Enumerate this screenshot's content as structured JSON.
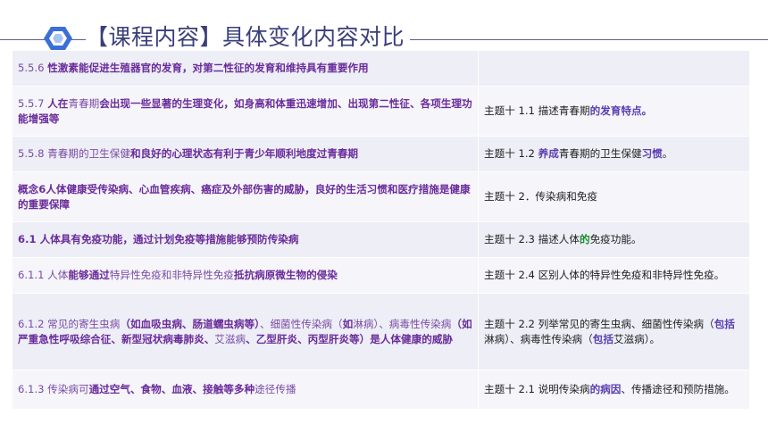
{
  "header": {
    "title": "【课程内容】具体变化内容对比"
  },
  "rows": [
    {
      "left": [
        {
          "t": "5.5.6 ",
          "s": "n"
        },
        {
          "t": "性激素能促进生殖器官的发育，对第二性征的发育和维持具有重要作用",
          "s": "b"
        }
      ],
      "right": []
    },
    {
      "left": [
        {
          "t": "5.5.7 ",
          "s": "n"
        },
        {
          "t": "人在",
          "s": "b"
        },
        {
          "t": "青春期",
          "s": "n"
        },
        {
          "t": "会出现一些显著的生理变化，如身高和体重迅速增加、出现第二性征、各项生理功能增强等",
          "s": "b"
        }
      ],
      "right": [
        {
          "t": "主题十 1.1 描述青春期",
          "s": "p"
        },
        {
          "t": "的发育特点。",
          "s": "rb"
        }
      ]
    },
    {
      "left": [
        {
          "t": "5.5.8 青春期的卫生保健",
          "s": "n"
        },
        {
          "t": "和良好的心理状态有利于青少年顺利地度过青春期",
          "s": "b"
        }
      ],
      "right": [
        {
          "t": "主题十 1.2 ",
          "s": "p"
        },
        {
          "t": "养成",
          "s": "rb"
        },
        {
          "t": "青春期的卫生保健",
          "s": "p"
        },
        {
          "t": "习惯",
          "s": "rb"
        },
        {
          "t": "。",
          "s": "p"
        }
      ]
    },
    {
      "left": [
        {
          "t": "概念6人体健康受传染病、心血管疾病、癌症及外部伤害的威胁，良好的生活习惯和医疗措施是健康的重要保障",
          "s": "b"
        }
      ],
      "right": [
        {
          "t": "主题十 2．传染病和免疫",
          "s": "p"
        }
      ]
    },
    {
      "left": [
        {
          "t": "6.1 人体具有免疫功能，通过计划免疫等措施能够预防传染病",
          "s": "b"
        }
      ],
      "right": [
        {
          "t": "主题十 2.3 描述人体",
          "s": "p"
        },
        {
          "t": "的",
          "s": "g"
        },
        {
          "t": "免疫功能。",
          "s": "p"
        }
      ]
    },
    {
      "left": [
        {
          "t": "6.1.1 人体",
          "s": "n"
        },
        {
          "t": "能够通过",
          "s": "b"
        },
        {
          "t": "特异性免疫和非特异性免疫",
          "s": "n"
        },
        {
          "t": "抵抗病原微生物的侵染",
          "s": "b"
        }
      ],
      "right": [
        {
          "t": "主题十 2.4 区别人体的特异性免疫和非特异性免疫。",
          "s": "p"
        }
      ]
    },
    {
      "left": [
        {
          "t": "6.1.2 常见的寄生虫病",
          "s": "n"
        },
        {
          "t": "（如血吸虫病、肠道蠕虫病等）",
          "s": "b"
        },
        {
          "t": "、细菌性传染病（",
          "s": "n"
        },
        {
          "t": "如",
          "s": "b"
        },
        {
          "t": "淋病）、病毒性传染病",
          "s": "n"
        },
        {
          "t": "（如严重急性呼吸综合征、新型冠状病毒肺炎、",
          "s": "b"
        },
        {
          "t": "艾滋病",
          "s": "n"
        },
        {
          "t": "、乙型肝炎、丙型肝炎等）是人体健康的威胁",
          "s": "b"
        }
      ],
      "right": [
        {
          "t": "主题十 2.2 列举常见的寄生虫病、细菌性传染病（",
          "s": "p"
        },
        {
          "t": "包括",
          "s": "rb"
        },
        {
          "t": "淋病）、病毒性传染病（",
          "s": "p"
        },
        {
          "t": "包括",
          "s": "rb"
        },
        {
          "t": "艾滋病）。",
          "s": "p"
        }
      ]
    },
    {
      "left": [
        {
          "t": "6.1.3 传染病可",
          "s": "n"
        },
        {
          "t": "通过空气、食物、血液、接触等多种",
          "s": "b"
        },
        {
          "t": "途径传播",
          "s": "n"
        }
      ],
      "right": [
        {
          "t": "主题十 2.1 说明传染病",
          "s": "p"
        },
        {
          "t": "的病因",
          "s": "rb"
        },
        {
          "t": "、传播途径和预防措施。",
          "s": "p"
        }
      ]
    }
  ]
}
